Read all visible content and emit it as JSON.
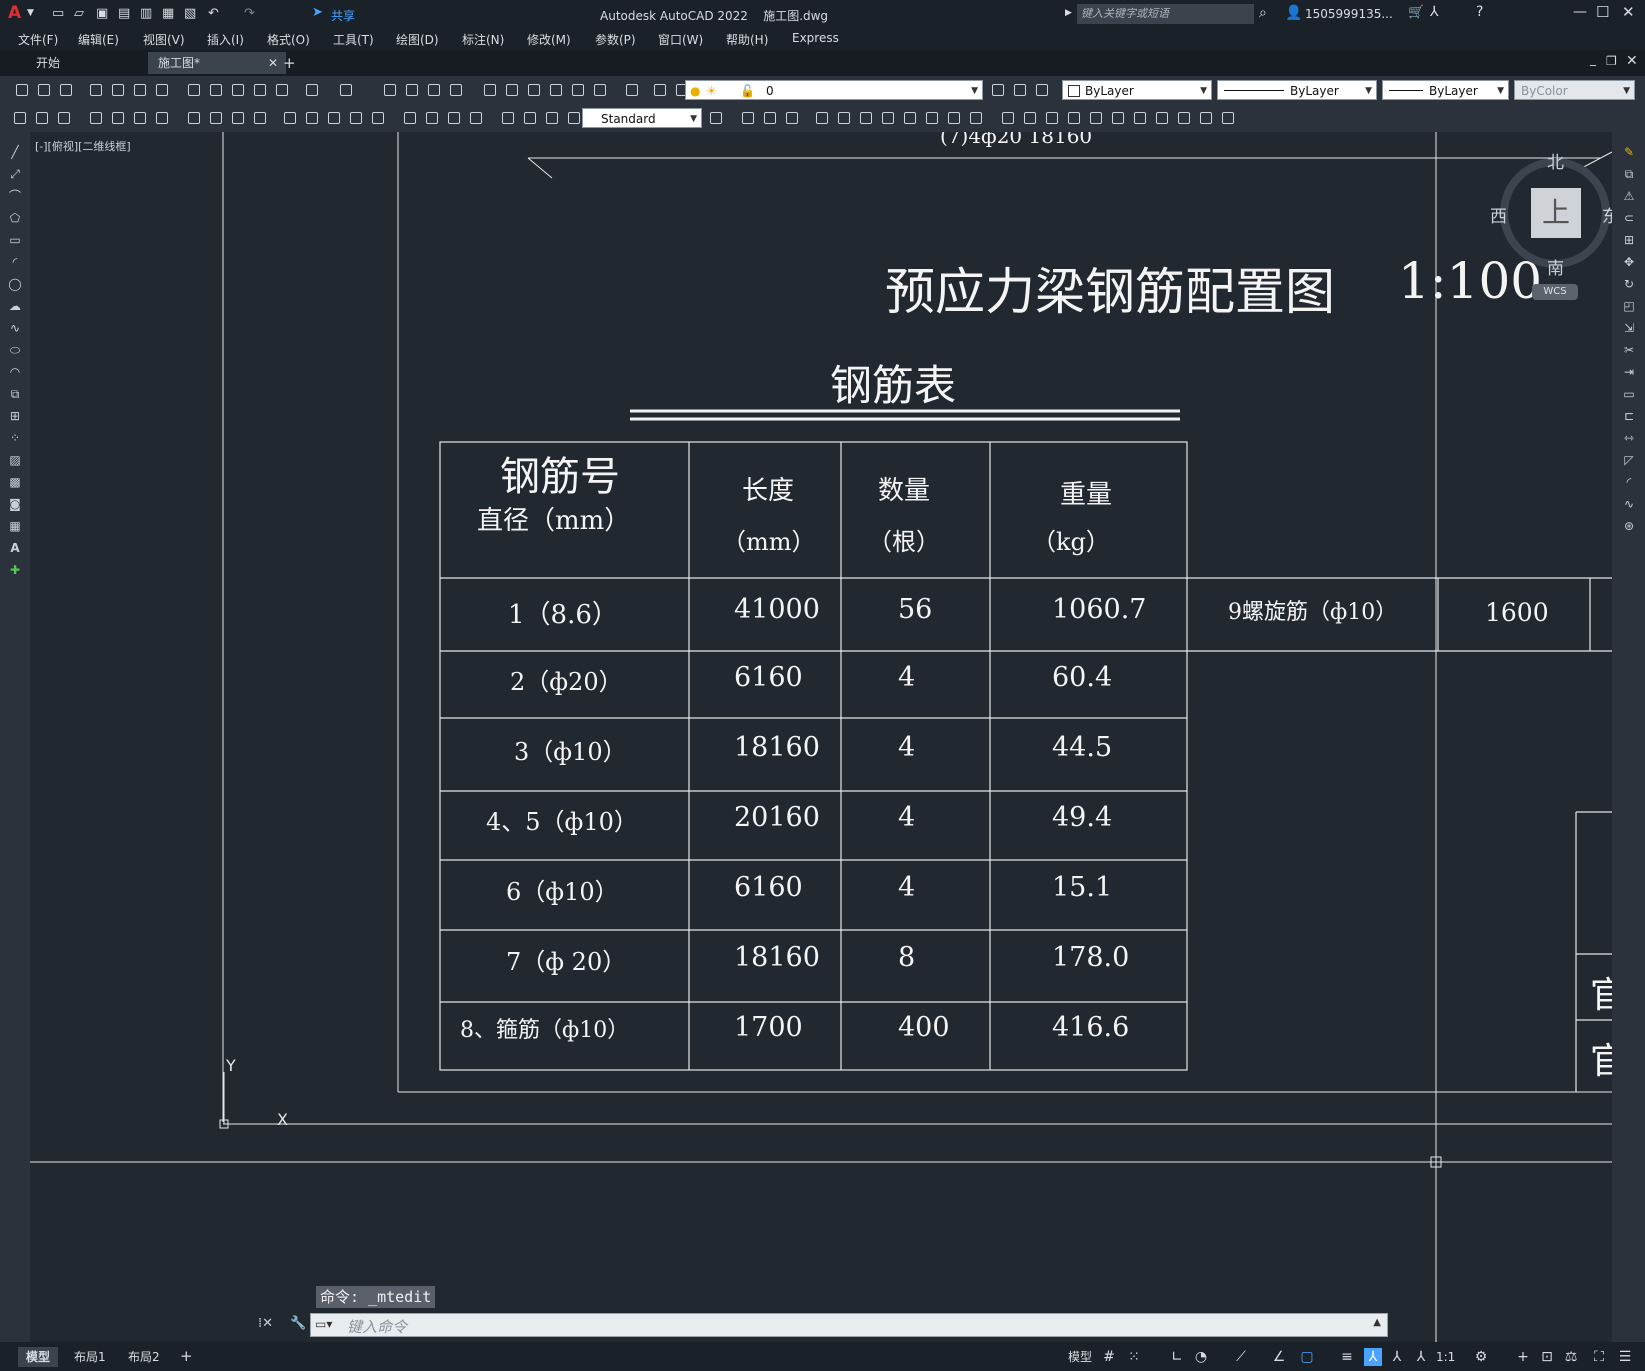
{
  "app": {
    "title": "Autodesk AutoCAD 2022",
    "filename": "施工图.dwg",
    "logo_letter": "A",
    "share_label": "共享",
    "search_placeholder": "键入关键字或短语",
    "user": "1505999135..."
  },
  "menu": [
    "文件(F)",
    "编辑(E)",
    "视图(V)",
    "插入(I)",
    "格式(O)",
    "工具(T)",
    "绘图(D)",
    "标注(N)",
    "修改(M)",
    "参数(P)",
    "窗口(W)",
    "帮助(H)",
    "Express"
  ],
  "tabs": [
    {
      "label": "开始"
    },
    {
      "label": "施工图*"
    }
  ],
  "toolbar": {
    "layer": "0",
    "color": "ByLayer",
    "linetype": "ByLayer",
    "lineweight": "ByLayer",
    "plotstyle": "ByColor",
    "textstyle": "Standard"
  },
  "viewport": {
    "label": "[-][俯视][二维线框]"
  },
  "viewcube": {
    "north": "北",
    "south": "南",
    "east": "东",
    "west": "西",
    "top": "上",
    "wcs": "WCS"
  },
  "drawing": {
    "partial_top_text": "(7)4ф20        18160",
    "main_title": "预应力梁钢筋配置图",
    "scale": "1:100",
    "table_title": "钢筋表",
    "headers": {
      "col1_line1": "钢筋号",
      "col1_line2": "直径（mm）",
      "col2_line1": "长度",
      "col2_line2": "（mm）",
      "col3_line1": "数量",
      "col3_line2": "（根）",
      "col4_line1": "重量",
      "col4_line2": "（kg）"
    },
    "rows": [
      {
        "id": "1（8.6）",
        "length": "41000",
        "count": "56",
        "weight": "1060.7"
      },
      {
        "id": "2（ф20）",
        "length": "6160",
        "count": "4",
        "weight": "60.4"
      },
      {
        "id": "3（ф10）",
        "length": "18160",
        "count": "4",
        "weight": "44.5"
      },
      {
        "id": "4、5（ф10）",
        "length": "20160",
        "count": "4",
        "weight": "49.4"
      },
      {
        "id": "6（ф10）",
        "length": "6160",
        "count": "4",
        "weight": "15.1"
      },
      {
        "id": "7（ф 20）",
        "length": "18160",
        "count": "8",
        "weight": "178.0"
      },
      {
        "id": "8、箍筋（ф10）",
        "length": "1700",
        "count": "400",
        "weight": "416.6"
      }
    ],
    "extra_row": {
      "id": "9螺旋筋（ф10）",
      "length": "1600"
    },
    "right_partial_1": "官",
    "right_partial_2": "官",
    "ucs_x": "X",
    "ucs_y": "Y"
  },
  "command": {
    "history": "命令: _mtedit",
    "placeholder": "键入命令"
  },
  "status": {
    "layout_tabs": [
      "模型",
      "布局1",
      "布局2"
    ],
    "model_label": "模型",
    "scale": "1:1"
  }
}
